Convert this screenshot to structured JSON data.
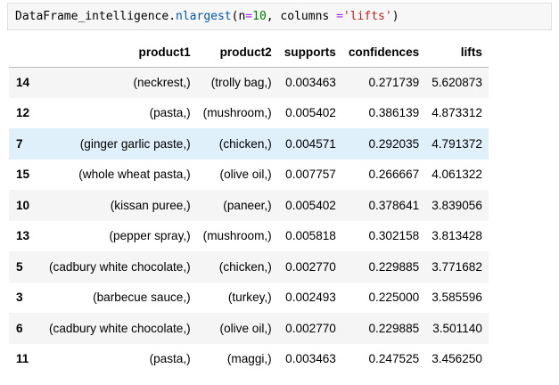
{
  "code": {
    "obj": "DataFrame_intelligence",
    "dot": ".",
    "method": "nlargest",
    "open": "(n",
    "eq1": "=",
    "n": "10",
    "mid": ", columns ",
    "eq2": "=",
    "arg": "'lifts'",
    "close": ")"
  },
  "table": {
    "columns": [
      "",
      "product1",
      "product2",
      "supports",
      "confidences",
      "lifts"
    ],
    "hover_row_index": 2,
    "rows": [
      {
        "index": "14",
        "product1": "(neckrest,)",
        "product2": "(trolly bag,)",
        "supports": "0.003463",
        "confidences": "0.271739",
        "lifts": "5.620873"
      },
      {
        "index": "12",
        "product1": "(pasta,)",
        "product2": "(mushroom,)",
        "supports": "0.005402",
        "confidences": "0.386139",
        "lifts": "4.873312"
      },
      {
        "index": "7",
        "product1": "(ginger garlic paste,)",
        "product2": "(chicken,)",
        "supports": "0.004571",
        "confidences": "0.292035",
        "lifts": "4.791372"
      },
      {
        "index": "15",
        "product1": "(whole wheat pasta,)",
        "product2": "(olive oil,)",
        "supports": "0.007757",
        "confidences": "0.266667",
        "lifts": "4.061322"
      },
      {
        "index": "10",
        "product1": "(kissan puree,)",
        "product2": "(paneer,)",
        "supports": "0.005402",
        "confidences": "0.378641",
        "lifts": "3.839056"
      },
      {
        "index": "13",
        "product1": "(pepper spray,)",
        "product2": "(mushroom,)",
        "supports": "0.005818",
        "confidences": "0.302158",
        "lifts": "3.813428"
      },
      {
        "index": "5",
        "product1": "(cadbury white chocolate,)",
        "product2": "(chicken,)",
        "supports": "0.002770",
        "confidences": "0.229885",
        "lifts": "3.771682"
      },
      {
        "index": "3",
        "product1": "(barbecue sauce,)",
        "product2": "(turkey,)",
        "supports": "0.002493",
        "confidences": "0.225000",
        "lifts": "3.585596"
      },
      {
        "index": "6",
        "product1": "(cadbury white chocolate,)",
        "product2": "(olive oil,)",
        "supports": "0.002770",
        "confidences": "0.229885",
        "lifts": "3.501140"
      },
      {
        "index": "11",
        "product1": "(pasta,)",
        "product2": "(maggi,)",
        "supports": "0.003463",
        "confidences": "0.247525",
        "lifts": "3.456250"
      }
    ]
  },
  "colors": {
    "hover_row": "#dff0fa",
    "code_bg": "#f7f7f7",
    "code_function": "#0055aa",
    "code_number": "#008000",
    "code_string": "#ba2121",
    "code_operator": "#aa22ff"
  }
}
